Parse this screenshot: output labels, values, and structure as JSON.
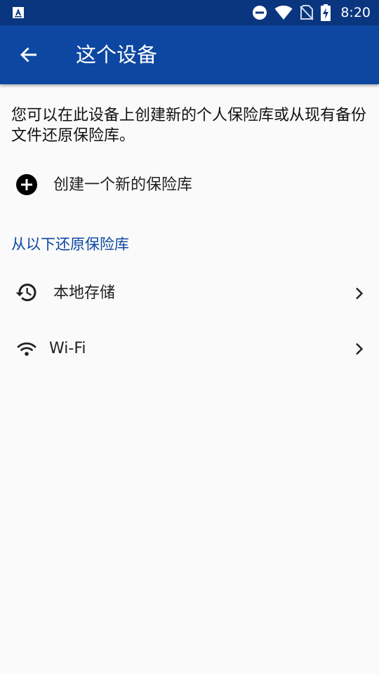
{
  "status_bar": {
    "time": "8:20",
    "icons": [
      "app-notification-icon",
      "do-not-disturb-icon",
      "wifi-icon",
      "no-sim-icon",
      "battery-charging-icon"
    ]
  },
  "app_bar": {
    "back_icon": "arrow-back-icon",
    "title": "这个设备"
  },
  "intro": "您可以在此设备上创建新的个人保险库或从现有备份文件还原保险库。",
  "create_vault": {
    "icon": "add-circle-icon",
    "label": "创建一个新的保险库"
  },
  "restore_section": {
    "header": "从以下还原保险库",
    "items": [
      {
        "icon": "history-icon",
        "label": "本地存储"
      },
      {
        "icon": "wifi-icon",
        "label": "Wi-Fi"
      }
    ]
  },
  "colors": {
    "status_bar": "#0a357f",
    "app_bar": "#0d47a1",
    "accent": "#0d47a1",
    "background": "#fafafa"
  }
}
